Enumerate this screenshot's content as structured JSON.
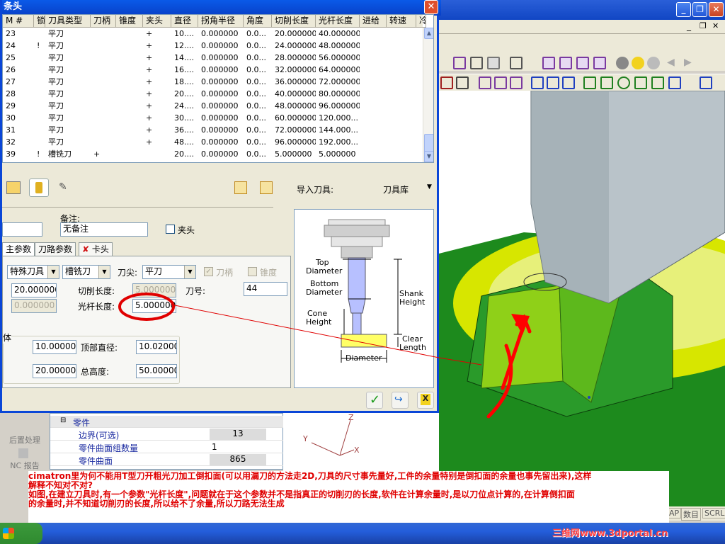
{
  "dialog": {
    "title": "条头",
    "close_label": "✕"
  },
  "grid": {
    "headers": [
      "M #",
      "锁",
      "刀具类型",
      "刀柄",
      "锥度",
      "夹头",
      "直径",
      "拐角半径",
      "角度",
      "切削长度",
      "光杆长度",
      "进给",
      "转速",
      "冷"
    ],
    "rows": [
      [
        "23",
        "",
        "平刀",
        "",
        "",
        "+",
        "10....",
        "0.000000",
        "0.0...",
        "20.000000",
        "40.000000",
        "",
        ""
      ],
      [
        "24",
        "!",
        "平刀",
        "",
        "",
        "+",
        "12....",
        "0.000000",
        "0.0...",
        "24.000000",
        "48.000000",
        "",
        ""
      ],
      [
        "25",
        "",
        "平刀",
        "",
        "",
        "+",
        "14....",
        "0.000000",
        "0.0...",
        "28.000000",
        "56.000000",
        "",
        ""
      ],
      [
        "26",
        "",
        "平刀",
        "",
        "",
        "+",
        "16....",
        "0.000000",
        "0.0...",
        "32.000000",
        "64.000000",
        "",
        ""
      ],
      [
        "27",
        "",
        "平刀",
        "",
        "",
        "+",
        "18....",
        "0.000000",
        "0.0...",
        "36.000000",
        "72.000000",
        "",
        ""
      ],
      [
        "28",
        "",
        "平刀",
        "",
        "",
        "+",
        "20....",
        "0.000000",
        "0.0...",
        "40.000000",
        "80.000000",
        "",
        ""
      ],
      [
        "29",
        "",
        "平刀",
        "",
        "",
        "+",
        "24....",
        "0.000000",
        "0.0...",
        "48.000000",
        "96.000000",
        "",
        ""
      ],
      [
        "30",
        "",
        "平刀",
        "",
        "",
        "+",
        "30....",
        "0.000000",
        "0.0...",
        "60.000000",
        "120.000...",
        "",
        ""
      ],
      [
        "31",
        "",
        "平刀",
        "",
        "",
        "+",
        "36....",
        "0.000000",
        "0.0...",
        "72.000000",
        "144.000...",
        "",
        ""
      ],
      [
        "32",
        "",
        "平刀",
        "",
        "",
        "+",
        "48....",
        "0.000000",
        "0.0...",
        "96.000000",
        "192.000...",
        "",
        ""
      ],
      [
        "39",
        "!",
        "槽铣刀",
        "+",
        "",
        "",
        "20....",
        "0.000000",
        "0.0...",
        "5.000000",
        "5.000000",
        "",
        ""
      ]
    ]
  },
  "toolbar": {
    "import_label": "导入刀具:",
    "library_label": "刀具库"
  },
  "form": {
    "remark_label": "备注:",
    "remark_value": "无备注",
    "collet_checkbox_label": "夹头",
    "tabs": [
      "主参数",
      "刀路参数",
      "卡头"
    ],
    "tool_family": "特殊刀具",
    "tool_type": "槽铣刀",
    "tip_label": "刀尖:",
    "tip_value": "平刀",
    "shank_label": "刀柄",
    "taper_label": "锥度",
    "diameter_value": "20.000000",
    "corner_value": "0.000000",
    "cut_length_label": "切削长度:",
    "cut_length_value": "5.000000",
    "shank_length_label": "光杆长度:",
    "shank_length_value": "5.000000",
    "tool_number_label": "刀号:",
    "tool_number_value": "44",
    "group_label": "体",
    "bottom_dia_value": "10.000000",
    "top_dia_label": "顶部直径:",
    "top_dia_value": "10.020000",
    "height_value": "20.000000",
    "total_height_label": "总高度:",
    "total_height_value": "50.000000"
  },
  "diagram": {
    "top_diameter": "Top\nDiameter",
    "bottom_diameter": "Bottom\nDiameter",
    "cone_height": "Cone\nHeight",
    "shank_height": "Shank\nHeight",
    "clear_length": "Clear\nLength",
    "diameter": "Diameter"
  },
  "lower_panel": {
    "sidebar": [
      "后置处理",
      "NC 报告"
    ],
    "section": "零件",
    "rows": [
      {
        "label": "边界(可选)",
        "value": "13"
      },
      {
        "label": "零件曲面组数量",
        "value": "1"
      },
      {
        "label": "零件曲面",
        "value": "865"
      }
    ]
  },
  "annotation": {
    "line1": "cimatron里为何不能用T型刀开粗光刀加工倒扣面(可以用漏刀的方法走2D,刀具的尺寸事先量好,工件的余量特别是倒扣面的余量也事先留出来),这样",
    "line2": "解释不知对不对?",
    "line3": "如图,在建立刀具时,有一个参数\"光杆长度\",问题就在于这个参数并不是指真正的切削刃的长度,软件在计算余量时,是以刀位点计算的,在计算倒扣面",
    "line4": "的余量时,并不知道切削刃的长度,所以给不了余量,所以刀路无法生成"
  },
  "status": [
    "AP",
    "数目",
    "SCRL"
  ],
  "watermark": "三维网www.3dportal.cn",
  "colors": {
    "dialog_blue": "#0a46d7",
    "annotation_red": "#e00000",
    "viewport_green": "#1d8a1d",
    "part_yellow": "#d7e600"
  }
}
